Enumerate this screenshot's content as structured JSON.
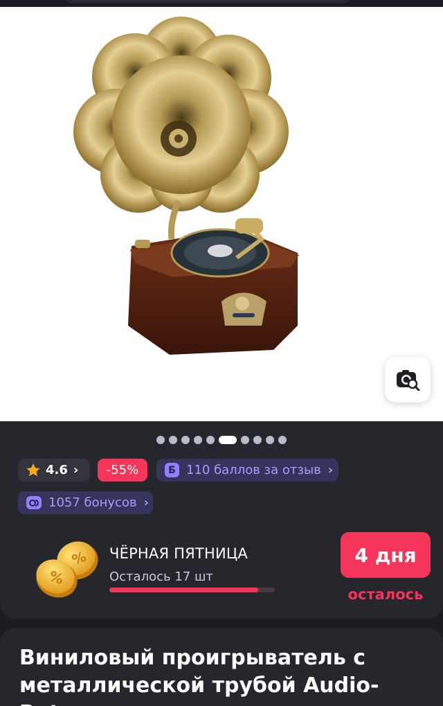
{
  "product": {
    "image_alt": "gramophone-vinyl-player",
    "title": "Виниловый проигрыватель с металлической трубой Audio-Retro"
  },
  "gallery": {
    "total_images": 10,
    "active_index": 5
  },
  "badges": {
    "rating": "4.6",
    "discount": "-55%",
    "review_reward_letter": "Б",
    "review_reward": "110 баллов за отзыв",
    "bonus": "1057 бонусов",
    "chevron": "›"
  },
  "promo": {
    "title": "ЧЁРНАЯ ПЯТНИЦА",
    "remaining": "Осталось 17 шт",
    "progress_fraction": 0.9,
    "days_left": "4 дня",
    "days_caption": "осталось"
  },
  "icons": {
    "star": "star-icon",
    "visual_search": "visual-search-icon",
    "coins": "coins-icon",
    "bonus": "bonus-coin-icon"
  },
  "colors": {
    "accent": "#f5355a",
    "bonus": "#a99bff",
    "star": "#ffa81a",
    "panel": "#26262d"
  }
}
